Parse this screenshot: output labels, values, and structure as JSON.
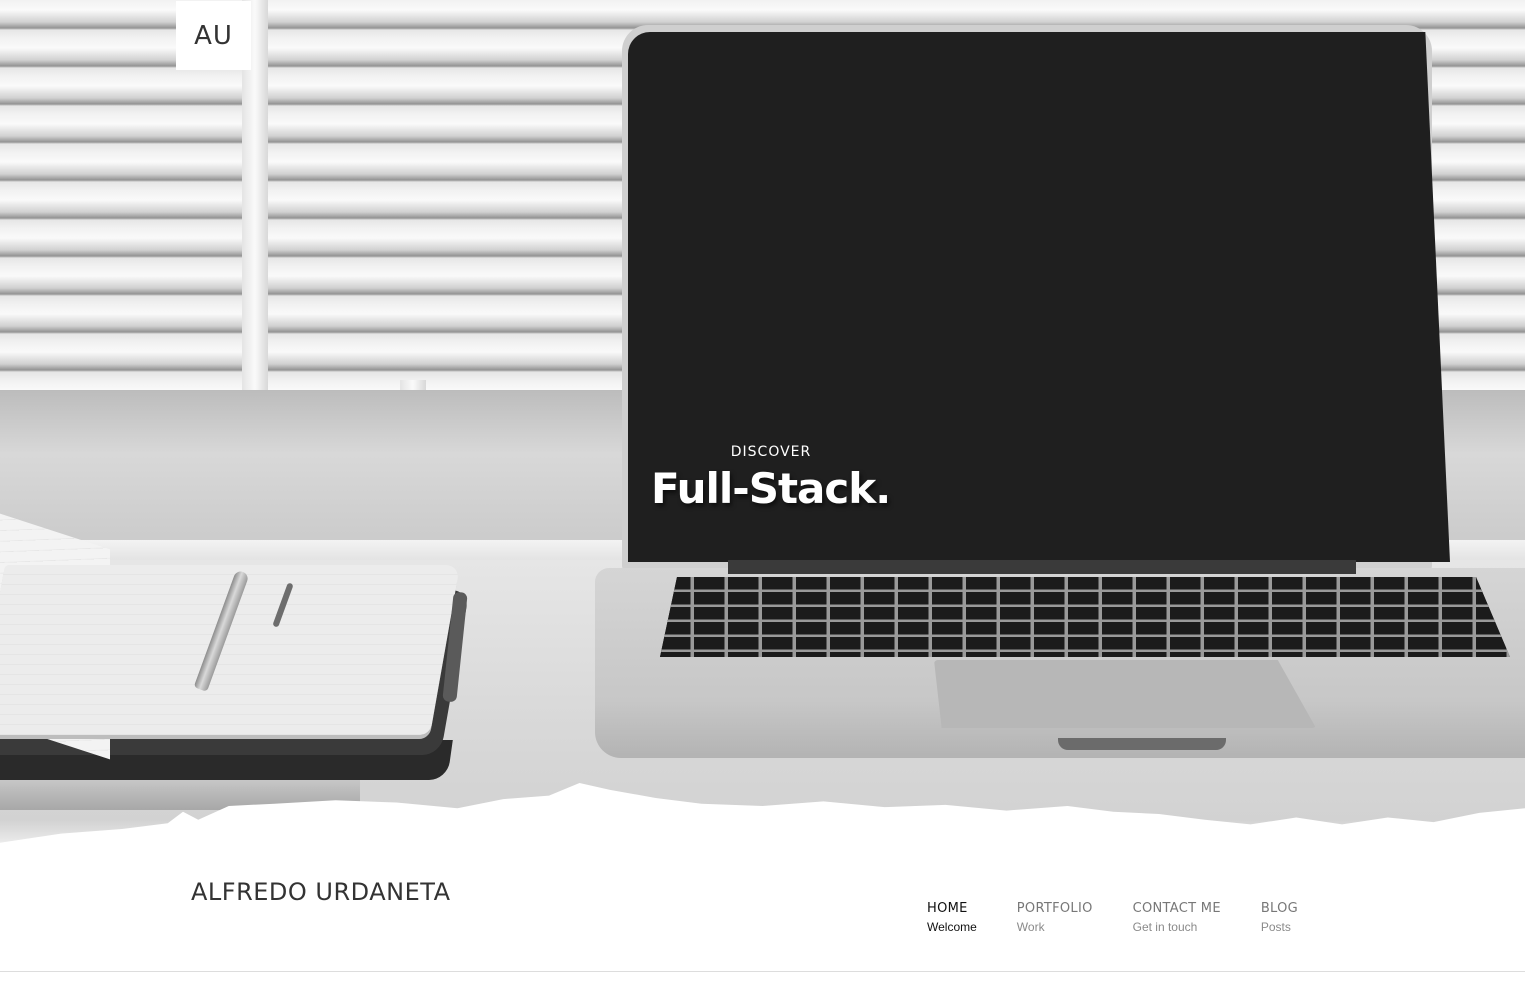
{
  "logo": {
    "text": "AU"
  },
  "hero": {
    "kicker": "DISCOVER",
    "title": "Full-Stack."
  },
  "site": {
    "name": "ALFREDO URDANETA"
  },
  "nav": {
    "items": [
      {
        "label": "HOME",
        "sub": "Welcome",
        "active": true
      },
      {
        "label": "PORTFOLIO",
        "sub": "Work",
        "active": false
      },
      {
        "label": "CONTACT ME",
        "sub": "Get in touch",
        "active": false
      },
      {
        "label": "BLOG",
        "sub": "Posts",
        "active": false
      }
    ]
  },
  "colors": {
    "active_nav": "#111111",
    "inactive_nav": "#777777",
    "hero_text": "#ffffff",
    "background": "#ffffff"
  }
}
